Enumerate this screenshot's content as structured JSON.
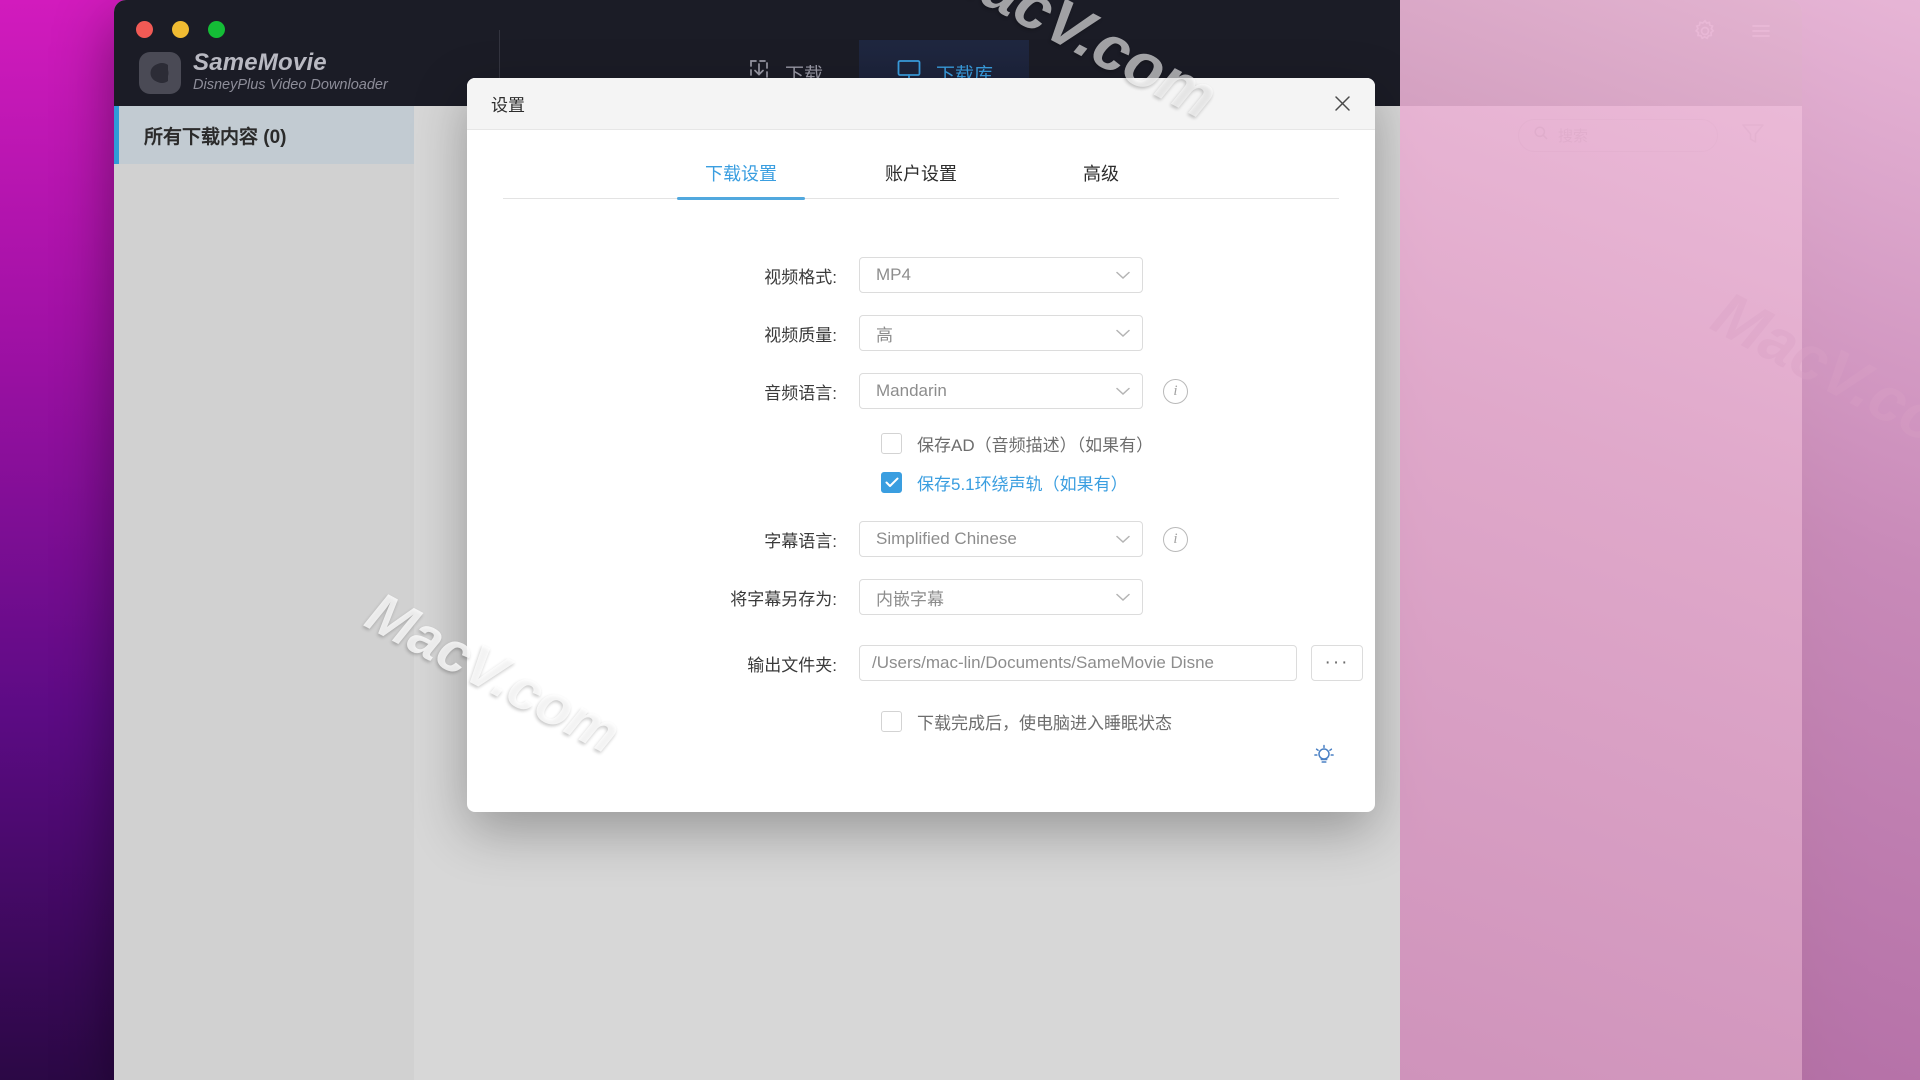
{
  "app": {
    "brand_name": "SameMovie",
    "brand_subtitle": "DisneyPlus Video Downloader",
    "accent_color": "#3a9ee0",
    "watermarks": [
      "MacV.com",
      "MacV.com",
      "MacV.com"
    ],
    "nav_tabs": [
      {
        "label": "下载",
        "icon": "download-icon",
        "active": false
      },
      {
        "label": "下载库",
        "icon": "library-monitor-icon",
        "active": true
      }
    ],
    "window_actions": [
      {
        "icon": "gear-icon",
        "label": "设置"
      },
      {
        "icon": "hamburger-menu-icon",
        "label": "菜单"
      }
    ],
    "sidebar": {
      "items": [
        {
          "label": "所有下载内容 (0)",
          "active": true
        }
      ]
    },
    "toolbar": {
      "search_placeholder": "搜索",
      "search_value": "",
      "filter_icon": "filter-funnel-icon"
    }
  },
  "settings_dialog": {
    "title": "设置",
    "close_label": "✕",
    "tabs": [
      {
        "label": "下载设置",
        "active": true
      },
      {
        "label": "账户设置",
        "active": false
      },
      {
        "label": "高级",
        "active": false
      }
    ],
    "fields": {
      "video_format": {
        "label": "视频格式:",
        "value": "MP4"
      },
      "video_quality": {
        "label": "视频质量:",
        "value": "高"
      },
      "audio_language": {
        "label": "音频语言:",
        "value": "Mandarin",
        "has_info": true
      },
      "subtitle_language": {
        "label": "字幕语言:",
        "value": "Simplified Chinese",
        "has_info": true
      },
      "save_subtitle_as": {
        "label": "将字幕另存为:",
        "value": "内嵌字幕"
      },
      "output_folder": {
        "label": "输出文件夹:",
        "value": "/Users/mac-lin/Documents/SameMovie Disne",
        "browse_label": "···"
      }
    },
    "checkboxes": [
      {
        "label": "保存AD（音频描述）（如果有）",
        "checked": false
      },
      {
        "label": "保存5.1环绕声轨（如果有）",
        "checked": true
      },
      {
        "label": "下载完成后，使电脑进入睡眠状态",
        "checked": false
      }
    ],
    "tip_icon": "lightbulb-tip-icon"
  }
}
